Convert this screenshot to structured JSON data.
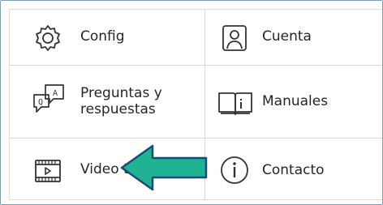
{
  "menu": {
    "items": [
      {
        "label": "Config",
        "icon": "gear-icon"
      },
      {
        "label": "Cuenta",
        "icon": "user-icon"
      },
      {
        "label": "Preguntas y respuestas",
        "icon": "qa-bubbles-icon"
      },
      {
        "label": "Manuales",
        "icon": "book-icon"
      },
      {
        "label": "Video tu",
        "icon": "video-icon"
      },
      {
        "label": "Contacto",
        "icon": "info-icon"
      }
    ]
  },
  "annotation": {
    "icon": "arrow-left-icon",
    "color": "#1fb394"
  }
}
